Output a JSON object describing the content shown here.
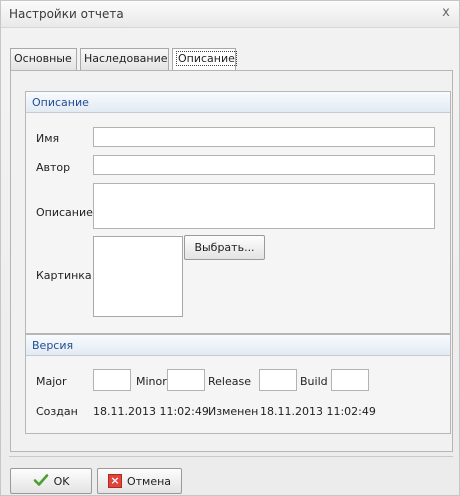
{
  "window": {
    "title": "Настройки отчета",
    "close_glyph": "x"
  },
  "tabs": [
    {
      "label": "Основные"
    },
    {
      "label": "Наследование"
    },
    {
      "label": "Описание"
    }
  ],
  "description_group": {
    "header": "Описание",
    "name_label": "Имя",
    "name_value": "",
    "author_label": "Автор",
    "author_value": "",
    "description_label": "Описание",
    "description_value": "",
    "picture_label": "Картинка",
    "choose_button": "Выбрать..."
  },
  "version_group": {
    "header": "Версия",
    "major_label": "Major",
    "major_value": "",
    "minor_label": "Minor",
    "minor_value": "",
    "release_label": "Release",
    "release_value": "",
    "build_label": "Build",
    "build_value": "",
    "created_label": "Создан",
    "created_value": "18.11.2013 11:02:49",
    "modified_label": "Изменен",
    "modified_value": "18.11.2013 11:02:49"
  },
  "footer": {
    "ok_label": "OK",
    "cancel_label": "Отмена"
  },
  "colors": {
    "group_header_text": "#1f4d93",
    "ok_icon": "#4aa02c",
    "cancel_icon": "#e0443a"
  }
}
